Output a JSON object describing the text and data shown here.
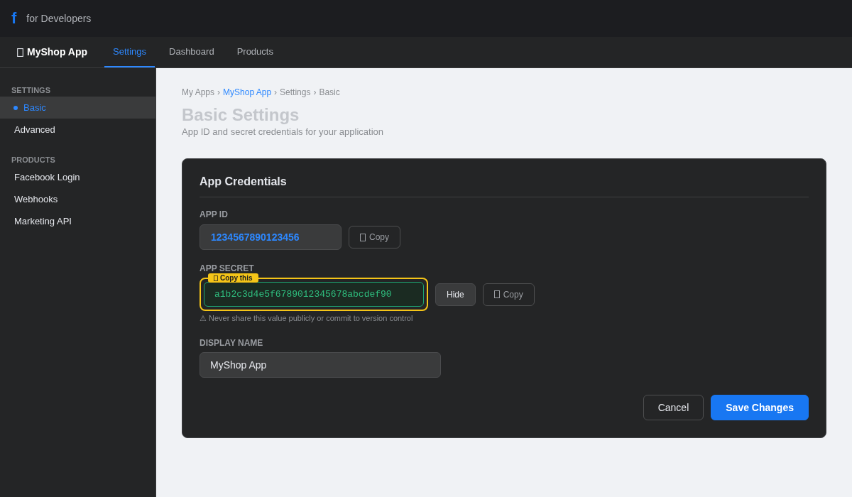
{
  "top_bar": {
    "logo": "f",
    "title": "for Developers"
  },
  "app_nav": {
    "app_name": "MyShop App",
    "tabs": [
      {
        "label": "Settings",
        "selected": true
      },
      {
        "label": "Dashboard",
        "selected": false
      },
      {
        "label": "Products",
        "selected": false
      }
    ]
  },
  "sidebar": {
    "sections": [
      {
        "heading": "SETTINGS",
        "items": [
          {
            "label": "Basic",
            "selected": true
          },
          {
            "label": "Advanced",
            "selected": false
          }
        ]
      },
      {
        "heading": "PRODUCTS",
        "items": [
          {
            "label": "Facebook Login",
            "selected": false
          },
          {
            "label": "Webhooks",
            "selected": false
          },
          {
            "label": "Marketing API",
            "selected": false
          }
        ]
      }
    ]
  },
  "breadcrumb": [
    {
      "kind": "text",
      "label": "My Apps"
    },
    {
      "kind": "separator",
      "label": "›"
    },
    {
      "kind": "link",
      "label": "MyShop App"
    },
    {
      "kind": "separator",
      "label": "›"
    },
    {
      "kind": "text",
      "label": "Settings"
    },
    {
      "kind": "separator",
      "label": "›"
    },
    {
      "kind": "text",
      "label": "Basic"
    }
  ],
  "page_title": "Basic Settings",
  "page_subtitle": "App ID and secret credentials for your application",
  "card": {
    "title": "App Credentials",
    "app_id": {
      "label": "APP ID",
      "value": "1234567890123456",
      "copy_button": "Copy"
    },
    "app_secret": {
      "label": "APP SECRET",
      "value": "a1b2c3d4e5f6789012345678abcdef90",
      "highlight": {
        "badge": "Copy this"
      },
      "hide_button": "Hide",
      "copy_button": "Copy",
      "hint": "⚠ Never share this value publicly or commit to version control"
    },
    "display_name": {
      "label": "DISPLAY NAME",
      "value": "MyShop App"
    },
    "actions": [
      {
        "kind": "secondary",
        "label": "Cancel"
      },
      {
        "kind": "primary",
        "label": "Save Changes"
      }
    ]
  }
}
